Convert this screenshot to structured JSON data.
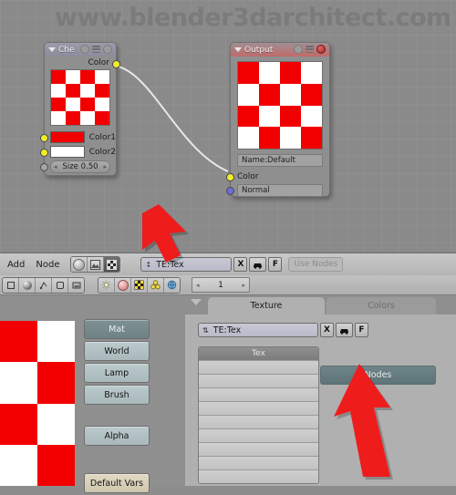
{
  "watermark": "www.blender3darchitect.com",
  "node_editor": {
    "nodes": [
      {
        "id": "checker",
        "title": "Che",
        "output_socket_label": "Color",
        "inputs": [
          {
            "label": "Color1",
            "color": "#f20000"
          },
          {
            "label": "Color2",
            "color": "#ffffff"
          }
        ],
        "slider": {
          "label": "Size 0.50",
          "left_arrow": "◂",
          "right_arrow": "▸"
        },
        "preview_colors": [
          "#f20000",
          "#ffffff"
        ]
      },
      {
        "id": "output",
        "title": "Output",
        "name_field": "Name:Default",
        "sockets": [
          {
            "label": "Color",
            "type": "color"
          },
          {
            "label": "Normal",
            "type": "vector"
          }
        ],
        "preview_colors": [
          "#f20000",
          "#ffffff"
        ]
      }
    ]
  },
  "toolbar": {
    "menus": [
      "Add",
      "Node"
    ],
    "mode_buttons": [
      {
        "name": "material-nodes-icon",
        "active": false
      },
      {
        "name": "composite-nodes-icon",
        "active": false
      },
      {
        "name": "texture-nodes-icon",
        "active": true
      }
    ],
    "datablock": {
      "value": "TE:Tex",
      "browse_icon": "↕",
      "delete_label": "X",
      "fakeuser_icon": "car-icon",
      "f_label": "F"
    },
    "use_nodes_label": "Use Nodes"
  },
  "toolbar2": {
    "view_buttons": [
      "object-icon",
      "material-sphere-icon",
      "constraint-icon",
      "modifier-icon",
      "image-icon"
    ],
    "tab_buttons": [
      "lamp-icon",
      "material-icon",
      "texture-icon",
      "radiosity-icon",
      "world-icon"
    ],
    "counter": {
      "value": "1",
      "left_arrow": "◂",
      "right_arrow": "▸"
    }
  },
  "left_panel": {
    "buttons": [
      {
        "label": "Mat",
        "selected": true
      },
      {
        "label": "World",
        "selected": false
      },
      {
        "label": "Lamp",
        "selected": false
      },
      {
        "label": "Brush",
        "selected": false
      }
    ],
    "alpha_label": "Alpha",
    "default_vars_label": "Default Vars",
    "preview_colors": [
      "#f20000",
      "#ffffff"
    ]
  },
  "right_panel": {
    "tabs": [
      {
        "label": "Texture",
        "active": true
      },
      {
        "label": "Colors",
        "active": false
      }
    ],
    "datablock": {
      "value": "TE:Tex",
      "browse_icon": "⇅",
      "delete_label": "X",
      "fakeuser_icon": "car-icon",
      "f_label": "F"
    },
    "texture_list": {
      "header": "Tex",
      "rows": [
        "",
        "",
        "",
        "",
        "",
        "",
        "",
        "",
        ""
      ]
    },
    "nodes_button_label": "Nodes"
  },
  "annotations": {
    "arrow_color": "#ef1c1c",
    "arrows": [
      {
        "name": "arrow-to-texture-nodes-button"
      },
      {
        "name": "arrow-to-nodes-button"
      }
    ]
  }
}
